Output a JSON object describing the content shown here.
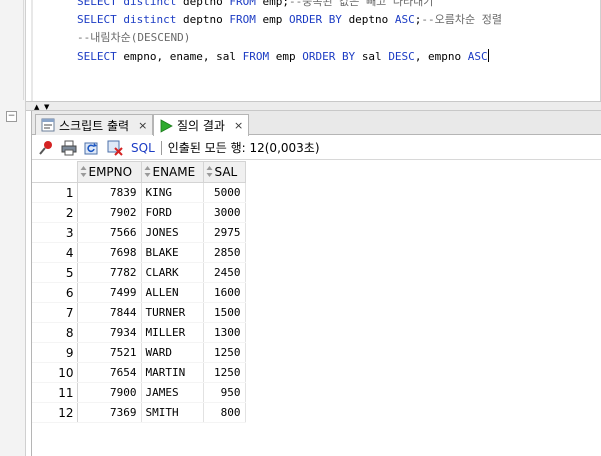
{
  "editor": {
    "lines": [
      {
        "parts": [
          {
            "t": "SELECT distinct ",
            "c": "kw"
          },
          {
            "t": "deptno ",
            "c": ""
          },
          {
            "t": "FROM ",
            "c": "kw"
          },
          {
            "t": "emp;",
            "c": ""
          },
          {
            "t": "--중복된 값은 빼고 나타내기",
            "c": "cm"
          }
        ]
      },
      {
        "parts": [
          {
            "t": "SELECT distinct ",
            "c": "kw"
          },
          {
            "t": "deptno ",
            "c": ""
          },
          {
            "t": "FROM ",
            "c": "kw"
          },
          {
            "t": "emp ",
            "c": ""
          },
          {
            "t": "ORDER BY ",
            "c": "kw"
          },
          {
            "t": "deptno ",
            "c": ""
          },
          {
            "t": "ASC",
            "c": "kw"
          },
          {
            "t": ";",
            "c": ""
          },
          {
            "t": "--오름차순 정렬",
            "c": "cm"
          }
        ]
      },
      {
        "parts": [
          {
            "t": "--내림차순(DESCEND)",
            "c": "cm"
          }
        ]
      },
      {
        "parts": [
          {
            "t": "SELECT ",
            "c": "kw"
          },
          {
            "t": "empno, ename, sal ",
            "c": ""
          },
          {
            "t": "FROM ",
            "c": "kw"
          },
          {
            "t": "emp ",
            "c": ""
          },
          {
            "t": "ORDER BY ",
            "c": "kw"
          },
          {
            "t": "sal ",
            "c": ""
          },
          {
            "t": "DESC",
            "c": "kw"
          },
          {
            "t": ", empno ",
            "c": ""
          },
          {
            "t": "ASC",
            "c": "kw"
          }
        ],
        "caret": true
      }
    ]
  },
  "splitter": {
    "up": "▲",
    "down": "▼"
  },
  "fold": {
    "symbol": "−"
  },
  "tabs": [
    {
      "label": "스크립트 출력",
      "close": "×"
    },
    {
      "label": "질의 결과",
      "close": "×"
    }
  ],
  "toolbar": {
    "sql_label": "SQL",
    "status": "인출된 모든 행: 12(0,003초)"
  },
  "grid": {
    "columns": [
      "EMPNO",
      "ENAME",
      "SAL"
    ],
    "rows": [
      [
        "1",
        "7839",
        "KING",
        "5000"
      ],
      [
        "2",
        "7902",
        "FORD",
        "3000"
      ],
      [
        "3",
        "7566",
        "JONES",
        "2975"
      ],
      [
        "4",
        "7698",
        "BLAKE",
        "2850"
      ],
      [
        "5",
        "7782",
        "CLARK",
        "2450"
      ],
      [
        "6",
        "7499",
        "ALLEN",
        "1600"
      ],
      [
        "7",
        "7844",
        "TURNER",
        "1500"
      ],
      [
        "8",
        "7934",
        "MILLER",
        "1300"
      ],
      [
        "9",
        "7521",
        "WARD",
        "1250"
      ],
      [
        "10",
        "7654",
        "MARTIN",
        "1250"
      ],
      [
        "11",
        "7900",
        "JAMES",
        "950"
      ],
      [
        "12",
        "7369",
        "SMITH",
        "800"
      ]
    ]
  },
  "colors": {
    "keyword": "#1c3cc4",
    "comment": "#6a6a6a",
    "run_green": "#2eaa2e",
    "pin_red": "#d42222"
  }
}
